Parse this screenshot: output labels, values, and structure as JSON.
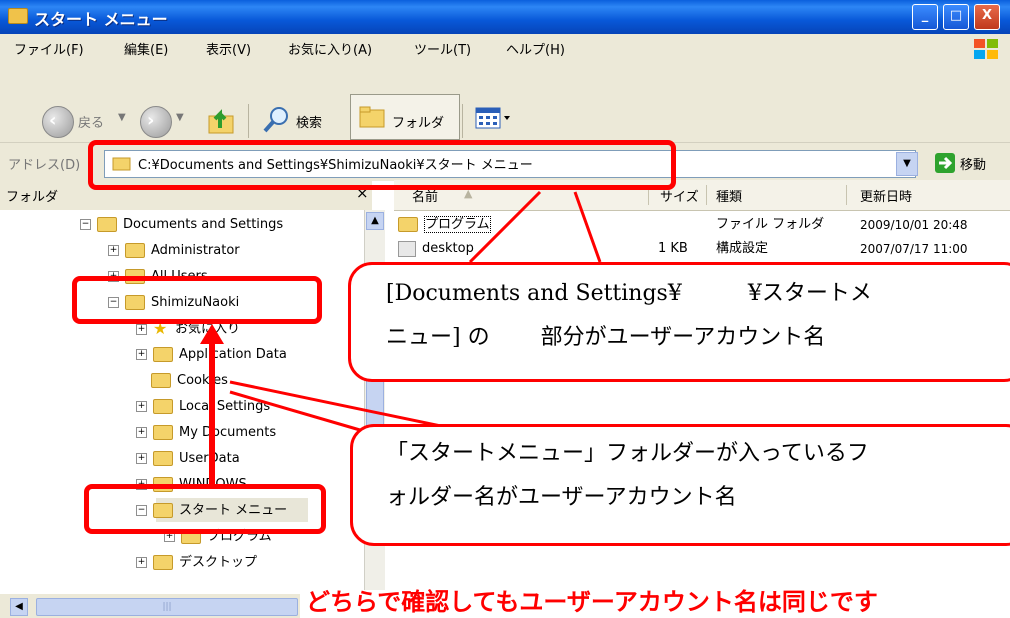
{
  "window": {
    "title": "スタート メニュー",
    "buttons": [
      "_",
      "□",
      "X"
    ]
  },
  "menu": [
    "ファイル(F)",
    "編集(E)",
    "表示(V)",
    "お気に入り(A)",
    "ツール(T)",
    "ヘルプ(H)"
  ],
  "toolbar": {
    "back": "戻る",
    "search": "検索",
    "folders": "フォルダ"
  },
  "address": {
    "label": "アドレス(D)",
    "value": "C:¥Documents and Settings¥ShimizuNaoki¥スタート メニュー",
    "go": "移動"
  },
  "folders_pane": {
    "header": "フォルダ",
    "close": "×",
    "items": [
      {
        "label": "Documents and Settings",
        "expander": "−"
      },
      {
        "label": "Administrator",
        "expander": "+"
      },
      {
        "label": "All Users",
        "expander": "+"
      },
      {
        "label": "ShimizuNaoki",
        "expander": "−"
      },
      {
        "label": "お気に入り",
        "expander": "+"
      },
      {
        "label": "Application Data",
        "expander": "+"
      },
      {
        "label": "Cookies",
        "expander": ""
      },
      {
        "label": "Local Settings",
        "expander": "+"
      },
      {
        "label": "My Documents",
        "expander": "+"
      },
      {
        "label": "UserData",
        "expander": "+"
      },
      {
        "label": "WINDOWS",
        "expander": "+"
      },
      {
        "label": "スタート メニュー",
        "expander": "−"
      },
      {
        "label": "プログラム",
        "expander": "+"
      },
      {
        "label": "デスクトップ",
        "expander": "+"
      }
    ]
  },
  "list": {
    "columns": [
      "名前",
      "サイズ",
      "種類",
      "更新日時"
    ],
    "sort_indicator": "▲",
    "rows": [
      {
        "name": "プログラム",
        "size": "",
        "type": "ファイル フォルダ",
        "date": "2009/10/01 20:48"
      },
      {
        "name": "desktop",
        "size": "1 KB",
        "type": "構成設定",
        "date": "2007/07/17 11:00"
      }
    ]
  },
  "annotations": {
    "callout1_line1": "[Documents and Settings¥　　　¥スタートメ",
    "callout1_line2": "ニュー] の　　 部分がユーザーアカウント名",
    "callout2_line1": "「スタートメニュー」フォルダーが入っているフ",
    "callout2_line2": "ォルダー名がユーザーアカウント名",
    "bottom_note": "どちらで確認してもユーザーアカウント名は同じです"
  },
  "colors": {
    "annotation": "#ff0000",
    "title_bar": "#0a5fdd",
    "chrome": "#ece9d8"
  }
}
